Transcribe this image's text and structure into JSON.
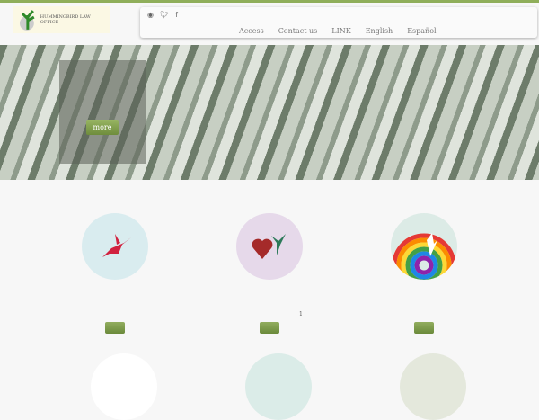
{
  "logo": {
    "text": "HUMMINGBIRD LAW OFFICE"
  },
  "social": [
    "rss-icon",
    "twitter-icon",
    "facebook-icon"
  ],
  "menu": [
    "Access",
    "Contact us",
    "LINK",
    "English",
    "Español"
  ],
  "hero": {
    "button": "more"
  },
  "features": {
    "page_number": "1",
    "colors": [
      "#d9ecef",
      "#e6d9ea",
      "#dcebe6"
    ]
  }
}
